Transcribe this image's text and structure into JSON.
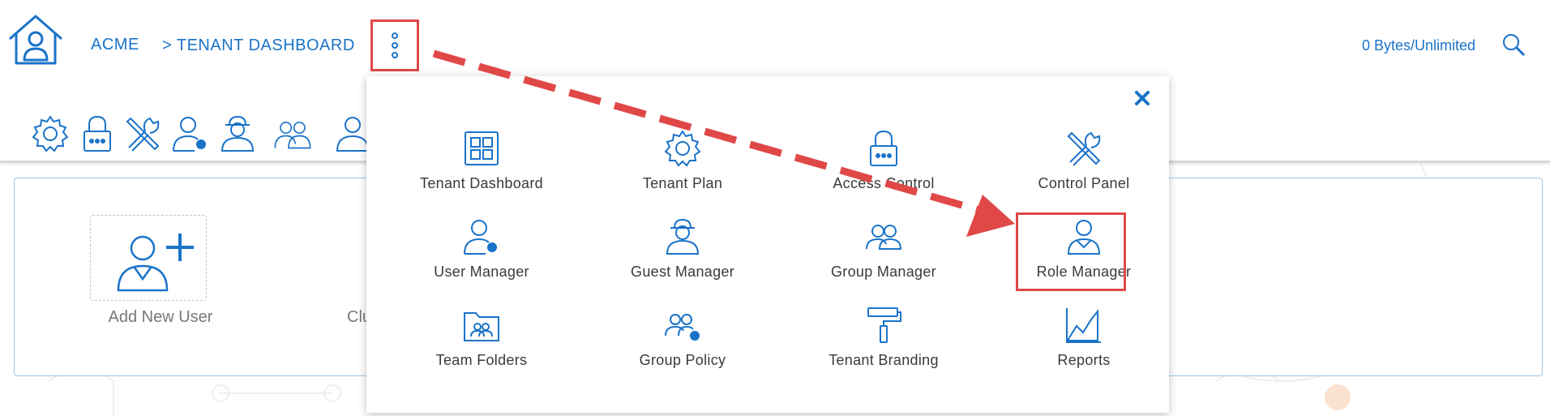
{
  "header": {
    "breadcrumb": [
      "ACME",
      "> TENANT DASHBOARD"
    ],
    "storage": "0 Bytes/Unlimited",
    "icons": [
      "home-icon",
      "more-vertical-icon",
      "search-icon"
    ]
  },
  "toolbar": {
    "icons": [
      "gear-icon",
      "lock-icon",
      "tools-icon",
      "user-settings-icon",
      "guest-icon",
      "group-icon",
      "role-icon"
    ]
  },
  "main": {
    "add_user_label": "Add New User",
    "partial_label": "Clu"
  },
  "menu": {
    "items": [
      {
        "label": "Tenant Dashboard",
        "icon": "grid-icon"
      },
      {
        "label": "Tenant Plan",
        "icon": "gear-icon"
      },
      {
        "label": "Access Control",
        "icon": "lock-icon"
      },
      {
        "label": "Control Panel",
        "icon": "tools-icon"
      },
      {
        "label": "User Manager",
        "icon": "user-settings-icon"
      },
      {
        "label": "Guest Manager",
        "icon": "guest-icon"
      },
      {
        "label": "Group Manager",
        "icon": "group-icon"
      },
      {
        "label": "Role Manager",
        "icon": "role-icon"
      },
      {
        "label": "Team Folders",
        "icon": "folder-users-icon"
      },
      {
        "label": "Group Policy",
        "icon": "group-policy-icon"
      },
      {
        "label": "Tenant Branding",
        "icon": "paint-roller-icon"
      },
      {
        "label": "Reports",
        "icon": "chart-icon"
      }
    ]
  },
  "colors": {
    "accent": "#1a73c9",
    "highlight": "#e04848"
  }
}
